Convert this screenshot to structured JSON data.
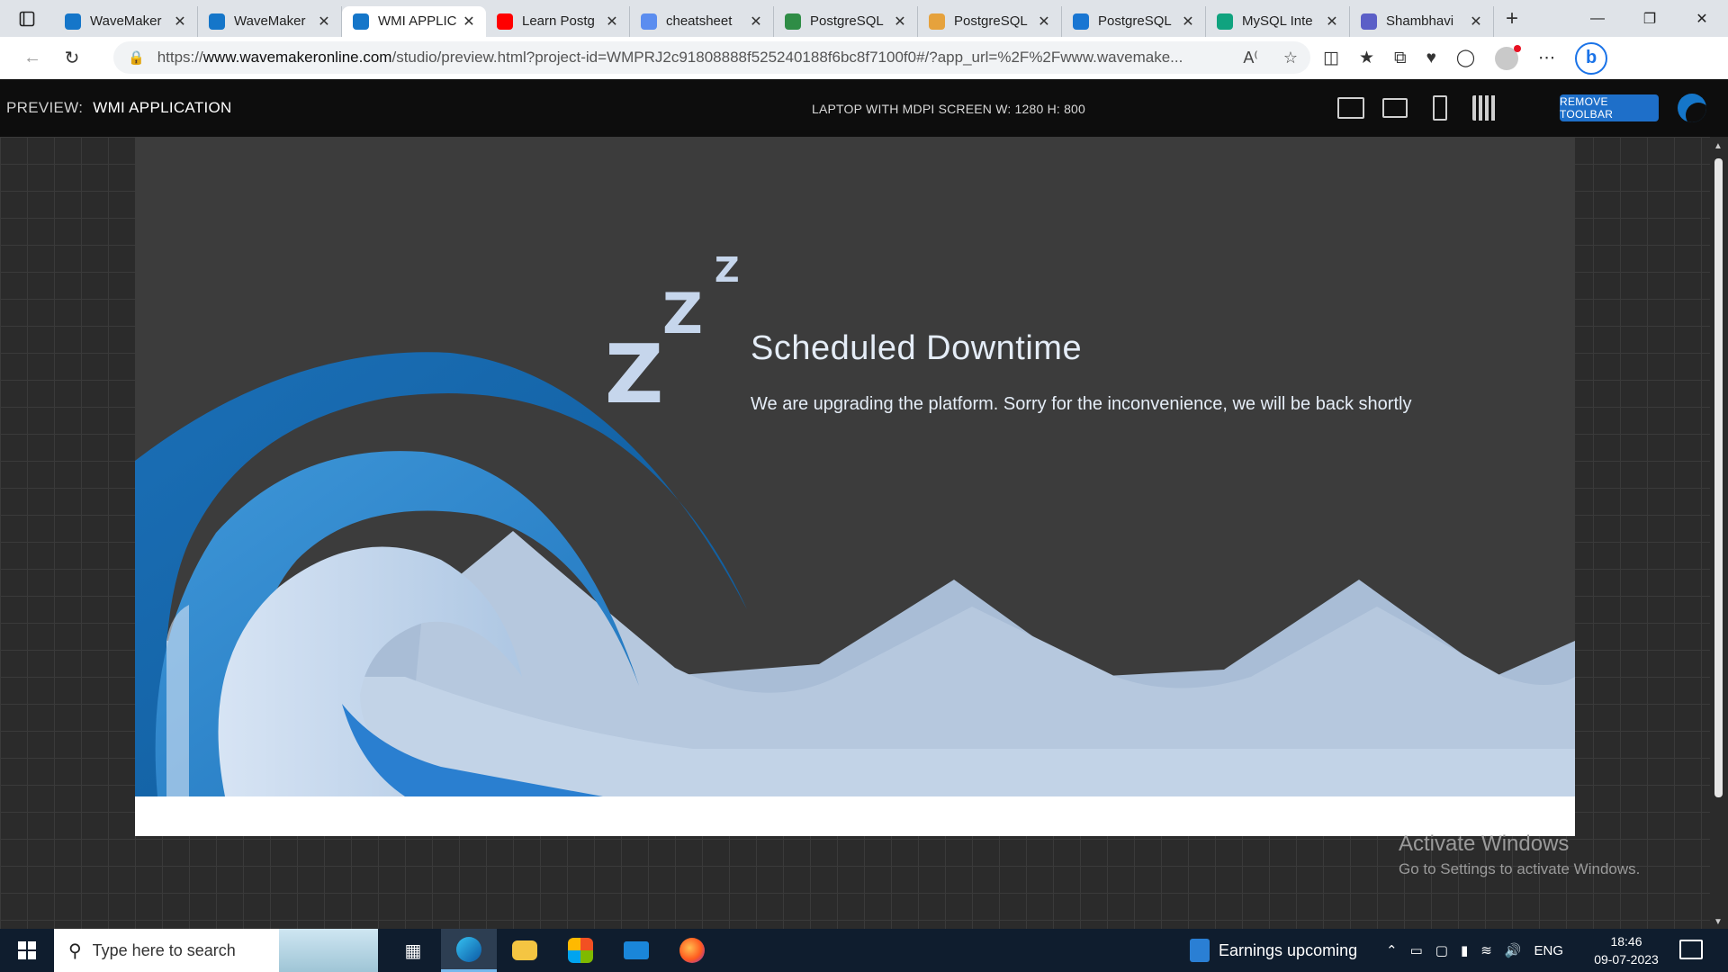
{
  "browser": {
    "tabs": [
      {
        "title": "WaveMaker",
        "favicon": "wavemaker-icon",
        "color": "#1576c9"
      },
      {
        "title": "WaveMaker",
        "favicon": "wavemaker-icon",
        "color": "#1576c9"
      },
      {
        "title": "WMI APPLIC",
        "favicon": "wavemaker-icon",
        "color": "#1576c9",
        "active": true
      },
      {
        "title": "Learn Postg",
        "favicon": "youtube-icon",
        "color": "#ff0000"
      },
      {
        "title": "cheatsheet",
        "favicon": "search-icon",
        "color": "#5b8def"
      },
      {
        "title": "PostgreSQL",
        "favicon": "gfg-icon",
        "color": "#2f8d46"
      },
      {
        "title": "PostgreSQL",
        "favicon": "globe-icon",
        "color": "#e6a23c"
      },
      {
        "title": "PostgreSQL",
        "favicon": "q-icon",
        "color": "#1976d2"
      },
      {
        "title": "MySQL Inte",
        "favicon": "chatgpt-icon",
        "color": "#10a37f"
      },
      {
        "title": "Shambhavi",
        "favicon": "teams-icon",
        "color": "#5b5fc7"
      }
    ],
    "url_prefix": "https://",
    "url_host": "www.wavemakeronline.com",
    "url_rest": "/studio/preview.html?project-id=WMPRJ2c91808888f525240188f6bc8f7100f0#/?app_url=%2F%2Fwww.wavemake..."
  },
  "preview_toolbar": {
    "label": "PREVIEW:",
    "app_name": "WMI APPLICATION",
    "device_info": "LAPTOP WITH MDPI SCREEN W: 1280 H: 800",
    "remove_toolbar": "REMOVE TOOLBAR"
  },
  "app": {
    "zz": [
      "Z",
      "Z",
      "Z"
    ],
    "title": "Scheduled Downtime",
    "message": "We are upgrading the platform. Sorry for the inconvenience, we will be back shortly"
  },
  "watermark": {
    "line1": "Activate Windows",
    "line2": "Go to Settings to activate Windows."
  },
  "taskbar": {
    "search_placeholder": "Type here to search",
    "news": "Earnings upcoming",
    "language": "ENG",
    "time": "18:46",
    "date": "09-07-2023"
  }
}
